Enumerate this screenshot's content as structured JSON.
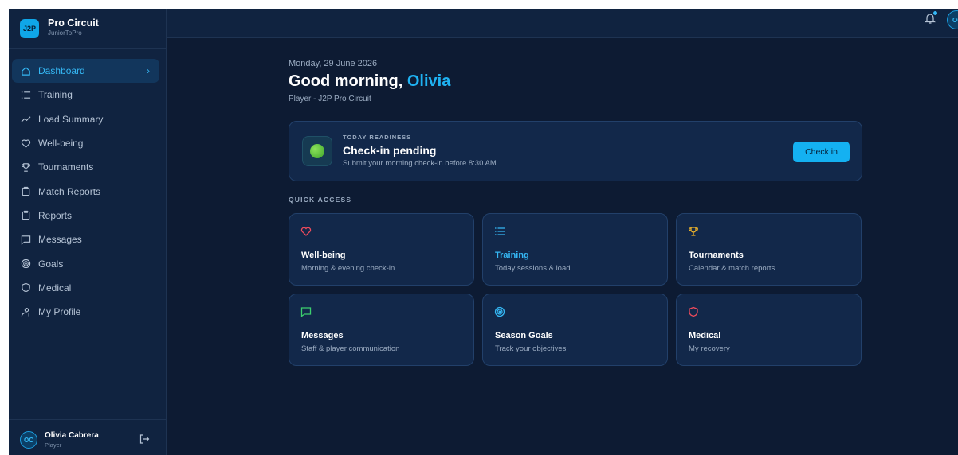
{
  "brand": {
    "logo_text": "J2P",
    "name": "Pro Circuit",
    "subtitle": "JuniorToPro"
  },
  "nav": {
    "items": [
      {
        "label": "Dashboard",
        "icon": "home-icon",
        "active": true
      },
      {
        "label": "Training",
        "icon": "list-icon"
      },
      {
        "label": "Load Summary",
        "icon": "trend-icon"
      },
      {
        "label": "Well-being",
        "icon": "heart-icon"
      },
      {
        "label": "Tournaments",
        "icon": "trophy-icon"
      },
      {
        "label": "Match Reports",
        "icon": "clipboard-icon"
      },
      {
        "label": "Reports",
        "icon": "clipboard-icon"
      },
      {
        "label": "Messages",
        "icon": "message-icon"
      },
      {
        "label": "Goals",
        "icon": "target-icon"
      },
      {
        "label": "Medical",
        "icon": "shield-icon"
      },
      {
        "label": "My Profile",
        "icon": "user-icon"
      }
    ],
    "chevron": "›"
  },
  "user": {
    "initials": "OC",
    "name": "Olivia Cabrera",
    "role": "Player"
  },
  "topbar": {
    "avatar_initials": "OC"
  },
  "main": {
    "date": "Monday, 29 June 2026",
    "greeting_prefix": "Good morning, ",
    "greeting_name": "Olivia",
    "role_line": "Player - J2P Pro Circuit",
    "readiness": {
      "kicker": "TODAY READINESS",
      "title": "Check-in pending",
      "subtitle": "Submit your morning check-in before 8:30 AM",
      "button_label": "Check in"
    },
    "quick_access_label": "QUICK ACCESS",
    "cards": [
      {
        "title": "Well-being",
        "subtitle": "Morning & evening check-in",
        "icon": "heart-icon",
        "icon_color": "#ef4b5c"
      },
      {
        "title": "Training",
        "subtitle": "Today sessions & load",
        "icon": "list-icon",
        "icon_color": "#35b8f5"
      },
      {
        "title": "Tournaments",
        "subtitle": "Calendar & match reports",
        "icon": "trophy-icon",
        "icon_color": "#f0b429"
      },
      {
        "title": "Messages",
        "subtitle": "Staff & player communication",
        "icon": "message-icon",
        "icon_color": "#3ccf6e"
      },
      {
        "title": "Season Goals",
        "subtitle": "Track your objectives",
        "icon": "target-icon",
        "icon_color": "#35b8f5"
      },
      {
        "title": "Medical",
        "subtitle": "My recovery",
        "icon": "shield-icon",
        "icon_color": "#ef4b5c"
      }
    ]
  },
  "colors": {
    "accent": "#14b1f1",
    "background": "#0d1b33",
    "sidebar": "#102340",
    "card": "#12284a"
  }
}
